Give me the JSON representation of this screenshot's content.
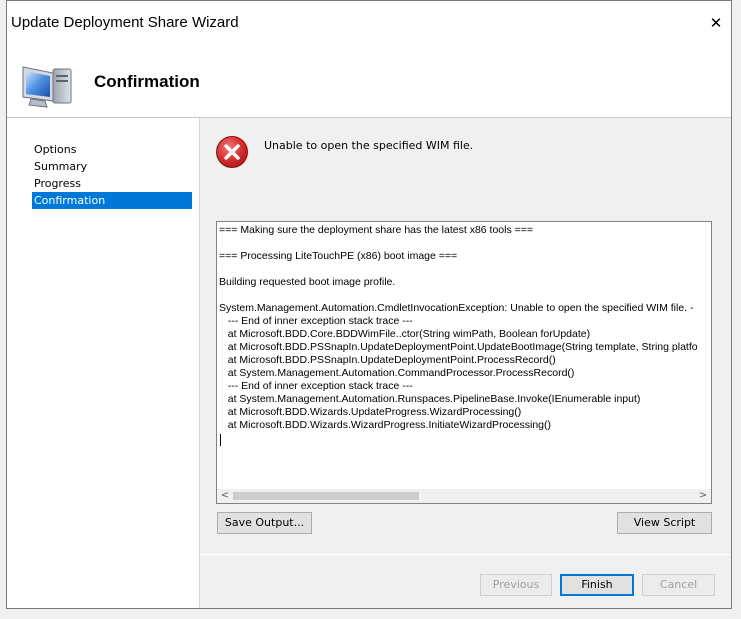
{
  "window": {
    "title": "Update Deployment Share Wizard",
    "close_glyph": "✕"
  },
  "header": {
    "title": "Confirmation",
    "icon": "computer-monitor-icon"
  },
  "sidebar": {
    "items": [
      {
        "label": "Options",
        "active": false
      },
      {
        "label": "Summary",
        "active": false
      },
      {
        "label": "Progress",
        "active": false
      },
      {
        "label": "Confirmation",
        "active": true
      }
    ]
  },
  "main": {
    "status_icon": "error-icon",
    "status_message": "Unable to open the specified WIM file.",
    "log_lines": [
      "=== Making sure the deployment share has the latest x86 tools ===",
      "",
      "=== Processing LiteTouchPE (x86) boot image ===",
      "",
      "Building requested boot image profile.",
      "",
      "System.Management.Automation.CmdletInvocationException: Unable to open the specified WIM file. -",
      "   --- End of inner exception stack trace ---",
      "   at Microsoft.BDD.Core.BDDWimFile..ctor(String wimPath, Boolean forUpdate)",
      "   at Microsoft.BDD.PSSnapIn.UpdateDeploymentPoint.UpdateBootImage(String template, String platfo",
      "   at Microsoft.BDD.PSSnapIn.UpdateDeploymentPoint.ProcessRecord()",
      "   at System.Management.Automation.CommandProcessor.ProcessRecord()",
      "   --- End of inner exception stack trace ---",
      "   at System.Management.Automation.Runspaces.PipelineBase.Invoke(IEnumerable input)",
      "   at Microsoft.BDD.Wizards.UpdateProgress.WizardProcessing()",
      "   at Microsoft.BDD.Wizards.WizardProgress.InitiateWizardProcessing()",
      ""
    ],
    "scroll_left_glyph": "<",
    "scroll_right_glyph": ">",
    "save_output_label": "Save Output...",
    "view_script_label": "View Script"
  },
  "footer": {
    "previous_label": "Previous",
    "finish_label": "Finish",
    "cancel_label": "Cancel"
  },
  "colors": {
    "accent": "#0078d7",
    "error": "#d32f2f"
  }
}
